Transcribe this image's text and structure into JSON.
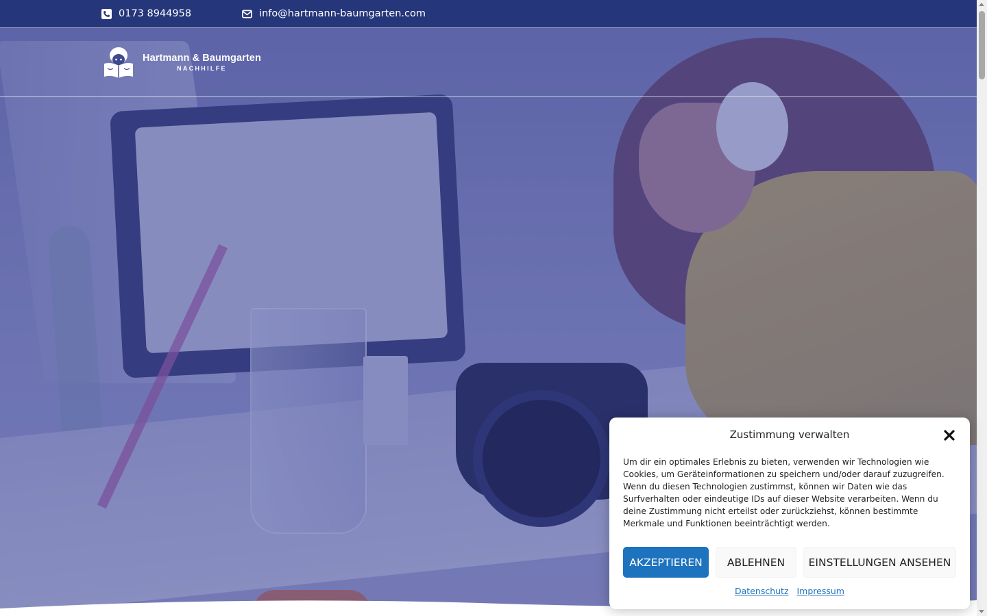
{
  "topbar": {
    "phone": "0173 8944958",
    "email": "info@hartmann-baumgarten.com"
  },
  "header": {
    "logo_title": "Hartmann & Baumgarten",
    "logo_subtitle": "NACHHILFE"
  },
  "cookie_banner": {
    "title": "Zustimmung verwalten",
    "text": "Um dir ein optimales Erlebnis zu bieten, verwenden wir Technologien wie Cookies, um Geräteinformationen zu speichern und/oder darauf zuzugreifen. Wenn du diesen Technologien zustimmst, können wir Daten wie das Surfverhalten oder eindeutige IDs auf dieser Website verarbeiten. Wenn du deine Zustimmung nicht erteilst oder zurückziehst, können bestimmte Merkmale und Funktionen beeinträchtigt werden.",
    "accept_label": "AKZEPTIEREN",
    "deny_label": "ABLEHNEN",
    "settings_label": "EINSTELLUNGEN ANSEHEN",
    "links": {
      "privacy": "Datenschutz",
      "imprint": "Impressum"
    }
  },
  "colors": {
    "topbar_bg": "#26367a",
    "hero_overlay": "#303a8c",
    "accept_button": "#1e73be",
    "link": "#1e73be"
  },
  "icons": {
    "phone": "phone-icon",
    "email": "envelope-icon",
    "close": "close-icon",
    "logo": "reading-child-logo"
  }
}
